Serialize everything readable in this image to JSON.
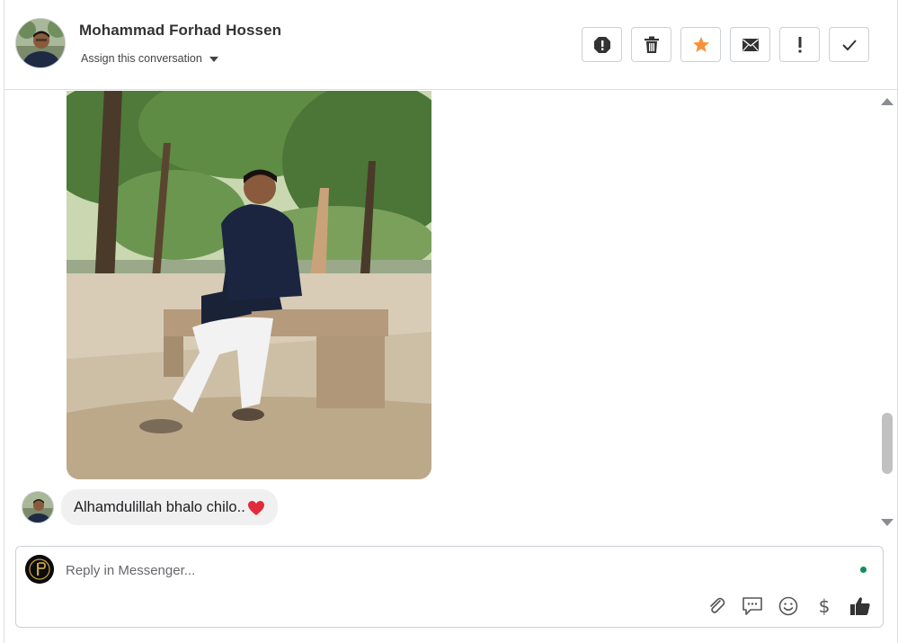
{
  "header": {
    "contact_name": "Mohammad Forhad Hossen",
    "assign_label": "Assign this conversation",
    "actions": [
      {
        "name": "spam-icon"
      },
      {
        "name": "trash-icon"
      },
      {
        "name": "star-icon",
        "color": "#f7923a"
      },
      {
        "name": "envelope-icon"
      },
      {
        "name": "exclamation-icon"
      },
      {
        "name": "checkmark-icon"
      }
    ]
  },
  "thread": {
    "message_text": "Alhamdulillah bhalo chilo..",
    "message_emoji": "heart",
    "emoji_color": "#e02c3c"
  },
  "reply": {
    "placeholder": "Reply in Messenger...",
    "status_color": "#0f8f55",
    "tools": [
      "paperclip-icon",
      "saved-replies-icon",
      "emoji-icon",
      "dollar-icon",
      "thumbs-up-icon"
    ],
    "dollar_symbol": "$"
  }
}
